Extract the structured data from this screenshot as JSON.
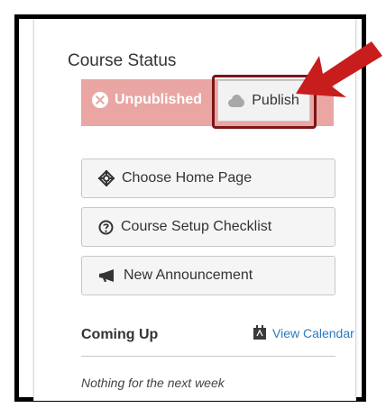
{
  "course_status": {
    "title": "Course Status",
    "unpublished_label": "Unpublished",
    "publish_label": "Publish"
  },
  "actions": {
    "home_page": "Choose Home Page",
    "setup_checklist": "Course Setup Checklist",
    "new_announcement": "New Announcement"
  },
  "coming_up": {
    "title": "Coming Up",
    "view_calendar": "View Calendar",
    "empty_message": "Nothing for the next week"
  },
  "colors": {
    "unpublished_bg": "#e9a6a3",
    "highlight_outline": "#7a1616",
    "arrow": "#c81d1d",
    "link": "#2a7abf"
  },
  "icons": {
    "unpublished": "x-circle-icon",
    "publish": "cloud-icon",
    "home_page": "crosshair-icon",
    "setup_checklist": "question-circle-icon",
    "new_announcement": "megaphone-icon",
    "calendar": "calendar-icon"
  }
}
